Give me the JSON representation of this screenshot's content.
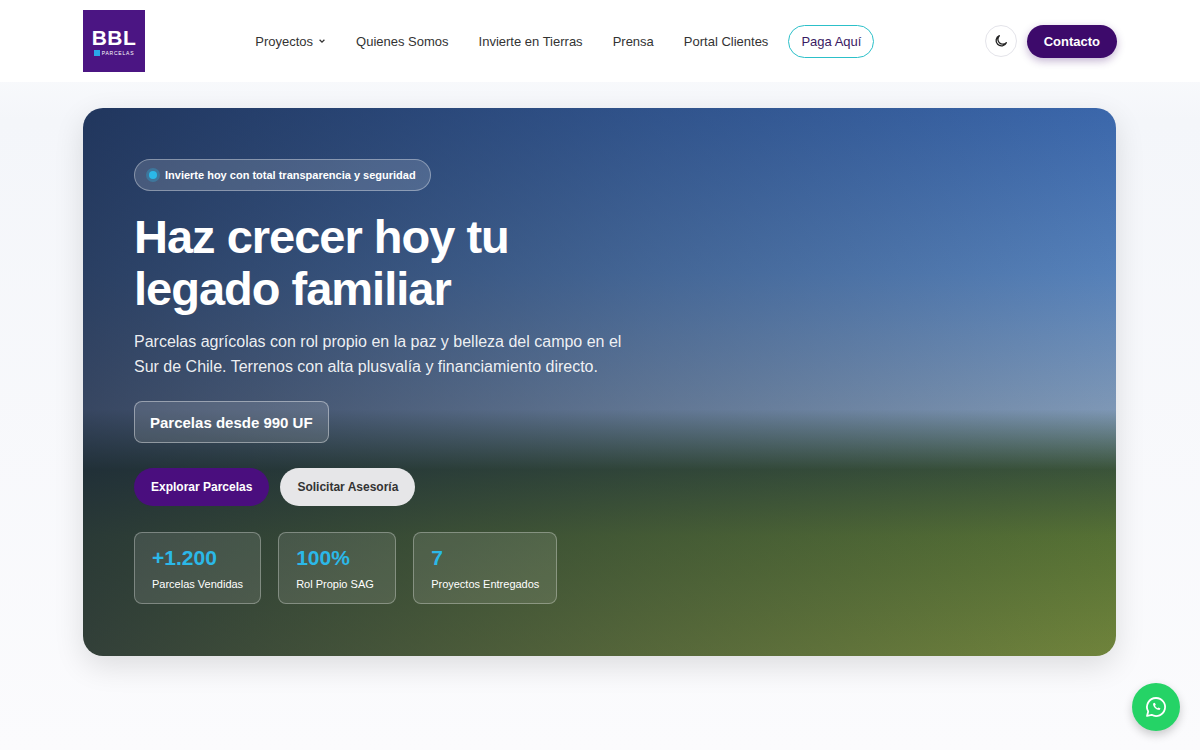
{
  "logo": {
    "text": "BBL",
    "subtext": "PARCELAS"
  },
  "nav": [
    {
      "label": "Proyectos",
      "dropdown": true,
      "kind": "link"
    },
    {
      "label": "Quienes Somos",
      "dropdown": false,
      "kind": "link"
    },
    {
      "label": "Invierte en Tierras",
      "dropdown": false,
      "kind": "link"
    },
    {
      "label": "Prensa",
      "dropdown": false,
      "kind": "link"
    },
    {
      "label": "Portal Clientes",
      "dropdown": false,
      "kind": "link"
    },
    {
      "label": "Paga Aquí",
      "dropdown": false,
      "kind": "outlined"
    }
  ],
  "theme_toggle": {
    "dark": false
  },
  "contact_button": "Contacto",
  "hero": {
    "badge": "Invierte hoy con total transparencia y seguridad",
    "title_lines": [
      "Haz crecer hoy tu",
      "legado familiar"
    ],
    "subtitle": "Parcelas agrícolas con rol propio en la paz y belleza del campo en el Sur de Chile. Terrenos con alta plusvalía y financiamiento directo.",
    "price": "Parcelas desde 990 UF",
    "buttons": [
      {
        "label": "Explorar Parcelas",
        "kind": "primary"
      },
      {
        "label": "Solicitar Asesoría",
        "kind": "secondary"
      }
    ],
    "stats": [
      {
        "value": "+1.200",
        "label": "Parcelas Vendidas"
      },
      {
        "value": "100%",
        "label": "Rol Propio SAG"
      },
      {
        "value": "7",
        "label": "Proyectos Entregados"
      }
    ]
  }
}
